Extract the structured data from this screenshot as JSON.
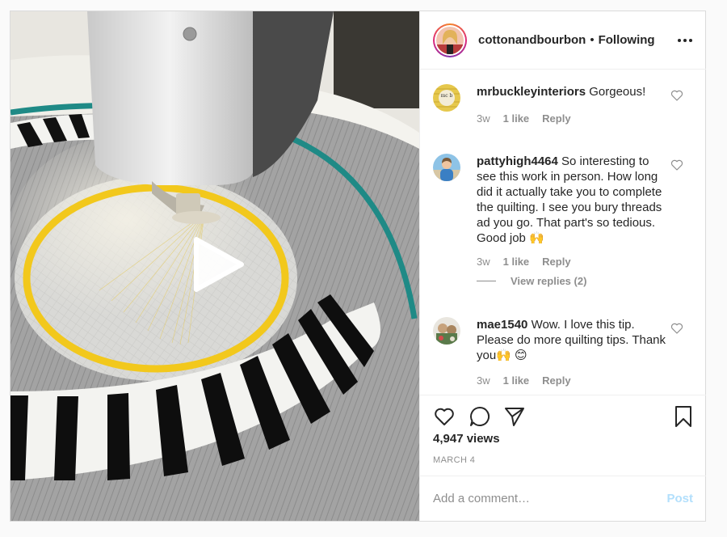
{
  "post": {
    "username": "cottonandbourbon",
    "separator": "•",
    "follow_status": "Following",
    "more_icon": "more-options-icon"
  },
  "comments": [
    {
      "username": "mrbuckleyinteriors",
      "text": "Gorgeous!",
      "age": "3w",
      "likes": "1 like",
      "reply_label": "Reply"
    },
    {
      "username": "pattyhigh4464",
      "text": "So interesting to see this work in person. How long did it actually take you to complete the quilting. I see you bury threads ad you go. That part's so tedious. Good job 🙌",
      "age": "3w",
      "likes": "1 like",
      "reply_label": "Reply",
      "view_replies": "View replies (2)"
    },
    {
      "username": "mae1540",
      "text": "Wow. I love this tip. Please do more quilting tips. Thank you🙌 😊",
      "age": "3w",
      "likes": "1 like",
      "reply_label": "Reply"
    }
  ],
  "avatars": {
    "mrbuckleyinteriors": "mc b"
  },
  "actions": {
    "views": "4,947 views",
    "date": "MARCH 4"
  },
  "add_comment": {
    "placeholder": "Add a comment…",
    "post_label": "Post"
  },
  "colors": {
    "post_button_disabled": "#b2dffc",
    "quilt_yellow": "#f2c81c",
    "quilt_teal": "#1f8a86"
  }
}
